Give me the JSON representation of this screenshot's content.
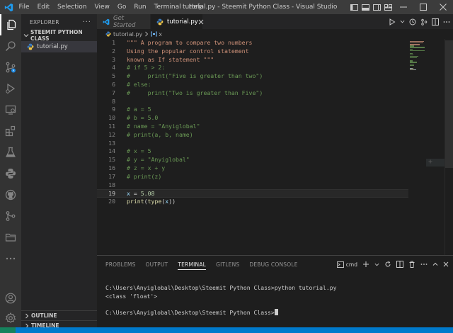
{
  "titlebar": {
    "menu": [
      "File",
      "Edit",
      "Selection",
      "View",
      "Go",
      "Run",
      "Terminal",
      "Help"
    ],
    "window_title": "tutorial.py - Steemit Python Class - Visual Studio Code"
  },
  "activity_bar": {
    "icons": [
      "explorer-icon",
      "search-icon",
      "source-control-icon",
      "run-debug-icon",
      "remote-explorer-icon",
      "extensions-icon",
      "testing-icon",
      "python-icon",
      "github-icon",
      "gitlens-icon",
      "folder-icon",
      "more-icon",
      "account-icon",
      "settings-gear-icon"
    ]
  },
  "sidebar": {
    "header": "EXPLORER",
    "more": "···",
    "folder": "STEEMIT PYTHON CLASS",
    "files": [
      {
        "name": "tutorial.py"
      }
    ],
    "outline": "OUTLINE",
    "timeline": "TIMELINE"
  },
  "tabs": [
    {
      "label": "Get Started",
      "active": false
    },
    {
      "label": "tutorial.py",
      "active": true
    }
  ],
  "breadcrumb": {
    "file": "tutorial.py",
    "symbol": "x"
  },
  "editor": {
    "current_line": 19,
    "lines": [
      {
        "n": "1",
        "tokens": [
          {
            "t": "\"\"\" A program to compare two numbers",
            "c": "str"
          }
        ]
      },
      {
        "n": "2",
        "tokens": [
          {
            "t": "Using the popular control statement",
            "c": "str"
          }
        ]
      },
      {
        "n": "3",
        "tokens": [
          {
            "t": "known as If statement \"\"\"",
            "c": "str"
          }
        ]
      },
      {
        "n": "4",
        "tokens": [
          {
            "t": "# if 5 > 2:",
            "c": "com"
          }
        ]
      },
      {
        "n": "5",
        "tokens": [
          {
            "t": "#     print(\"Five is greater than two\")",
            "c": "com"
          }
        ]
      },
      {
        "n": "6",
        "tokens": [
          {
            "t": "# else:",
            "c": "com"
          }
        ]
      },
      {
        "n": "7",
        "tokens": [
          {
            "t": "#     print(\"Two is greater than Five\")",
            "c": "com"
          }
        ]
      },
      {
        "n": "8",
        "tokens": []
      },
      {
        "n": "9",
        "tokens": [
          {
            "t": "# a = 5",
            "c": "com"
          }
        ]
      },
      {
        "n": "10",
        "tokens": [
          {
            "t": "# b = 5.0",
            "c": "com"
          }
        ]
      },
      {
        "n": "11",
        "tokens": [
          {
            "t": "# name = \"Anyiglobal\"",
            "c": "com"
          }
        ]
      },
      {
        "n": "12",
        "tokens": [
          {
            "t": "# print(a, b, name)",
            "c": "com"
          }
        ]
      },
      {
        "n": "13",
        "tokens": []
      },
      {
        "n": "14",
        "tokens": [
          {
            "t": "# x = 5",
            "c": "com"
          }
        ]
      },
      {
        "n": "15",
        "tokens": [
          {
            "t": "# y = \"Anyiglobal\"",
            "c": "com"
          }
        ]
      },
      {
        "n": "16",
        "tokens": [
          {
            "t": "# z = x + y",
            "c": "com"
          }
        ]
      },
      {
        "n": "17",
        "tokens": [
          {
            "t": "# print(z)",
            "c": "com"
          }
        ]
      },
      {
        "n": "18",
        "tokens": []
      },
      {
        "n": "19",
        "tokens": [
          {
            "t": "x",
            "c": "var"
          },
          {
            "t": " = ",
            "c": "op"
          },
          {
            "t": "5.08",
            "c": "num"
          }
        ]
      },
      {
        "n": "20",
        "tokens": [
          {
            "t": "print",
            "c": "fn"
          },
          {
            "t": "(",
            "c": "punc"
          },
          {
            "t": "type",
            "c": "fn"
          },
          {
            "t": "(",
            "c": "punc"
          },
          {
            "t": "x",
            "c": "var"
          },
          {
            "t": "))",
            "c": "punc"
          }
        ]
      }
    ]
  },
  "colors": {
    "string": "#ce9178",
    "comment": "#6a9955",
    "variable": "#9cdcfe",
    "number": "#b5cea8",
    "function": "#dcdcaa",
    "statusbar": "#007acc",
    "accent": "#0078d4"
  },
  "panel": {
    "tabs": [
      "PROBLEMS",
      "OUTPUT",
      "TERMINAL",
      "GITLENS",
      "DEBUG CONSOLE"
    ],
    "active_tab": "TERMINAL",
    "terminal_name": "cmd",
    "terminal_lines": [
      "C:\\Users\\Anyiglobal\\Desktop\\Steemit Python Class>python tutorial.py",
      "<class 'float'>",
      "",
      "C:\\Users\\Anyiglobal\\Desktop\\Steemit Python Class>"
    ]
  }
}
